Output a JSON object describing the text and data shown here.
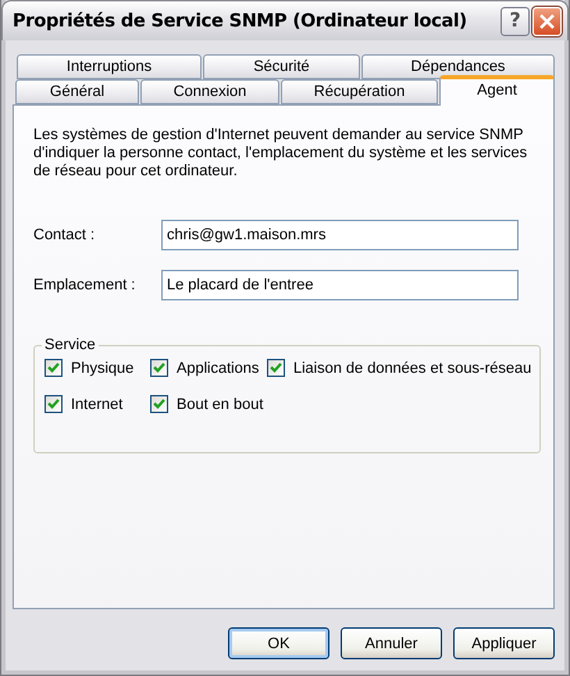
{
  "window": {
    "title": "Propriétés de Service SNMP (Ordinateur local)",
    "help": "?"
  },
  "tab_rows": [
    [
      {
        "label": "Interruptions",
        "selected": false
      },
      {
        "label": "Sécurité",
        "selected": false
      },
      {
        "label": "Dépendances",
        "selected": false
      }
    ],
    [
      {
        "label": "Général",
        "selected": false
      },
      {
        "label": "Connexion",
        "selected": false
      },
      {
        "label": "Récupération",
        "selected": false
      },
      {
        "label": "Agent",
        "selected": true
      }
    ]
  ],
  "description": "Les systèmes de gestion d'Internet peuvent demander au service SNMP d'indiquer la personne contact, l'emplacement du système et les services de réseau pour cet ordinateur.",
  "fields": [
    {
      "label": "Contact :",
      "value": "chris@gw1.maison.mrs"
    },
    {
      "label": "Emplacement :",
      "value": "Le placard de l'entree"
    }
  ],
  "service": {
    "title": "Service",
    "rows": [
      [
        {
          "label": "Physique",
          "checked": true
        },
        {
          "label": "Applications",
          "checked": true
        },
        {
          "label": "Liaison de données et sous-réseau",
          "checked": true
        }
      ],
      [
        {
          "label": "Internet",
          "checked": true
        },
        {
          "label": "Bout en bout",
          "checked": true
        }
      ]
    ]
  },
  "buttons": [
    {
      "label": "OK",
      "default": true
    },
    {
      "label": "Annuler",
      "default": false
    },
    {
      "label": "Appliquer",
      "default": false
    }
  ]
}
